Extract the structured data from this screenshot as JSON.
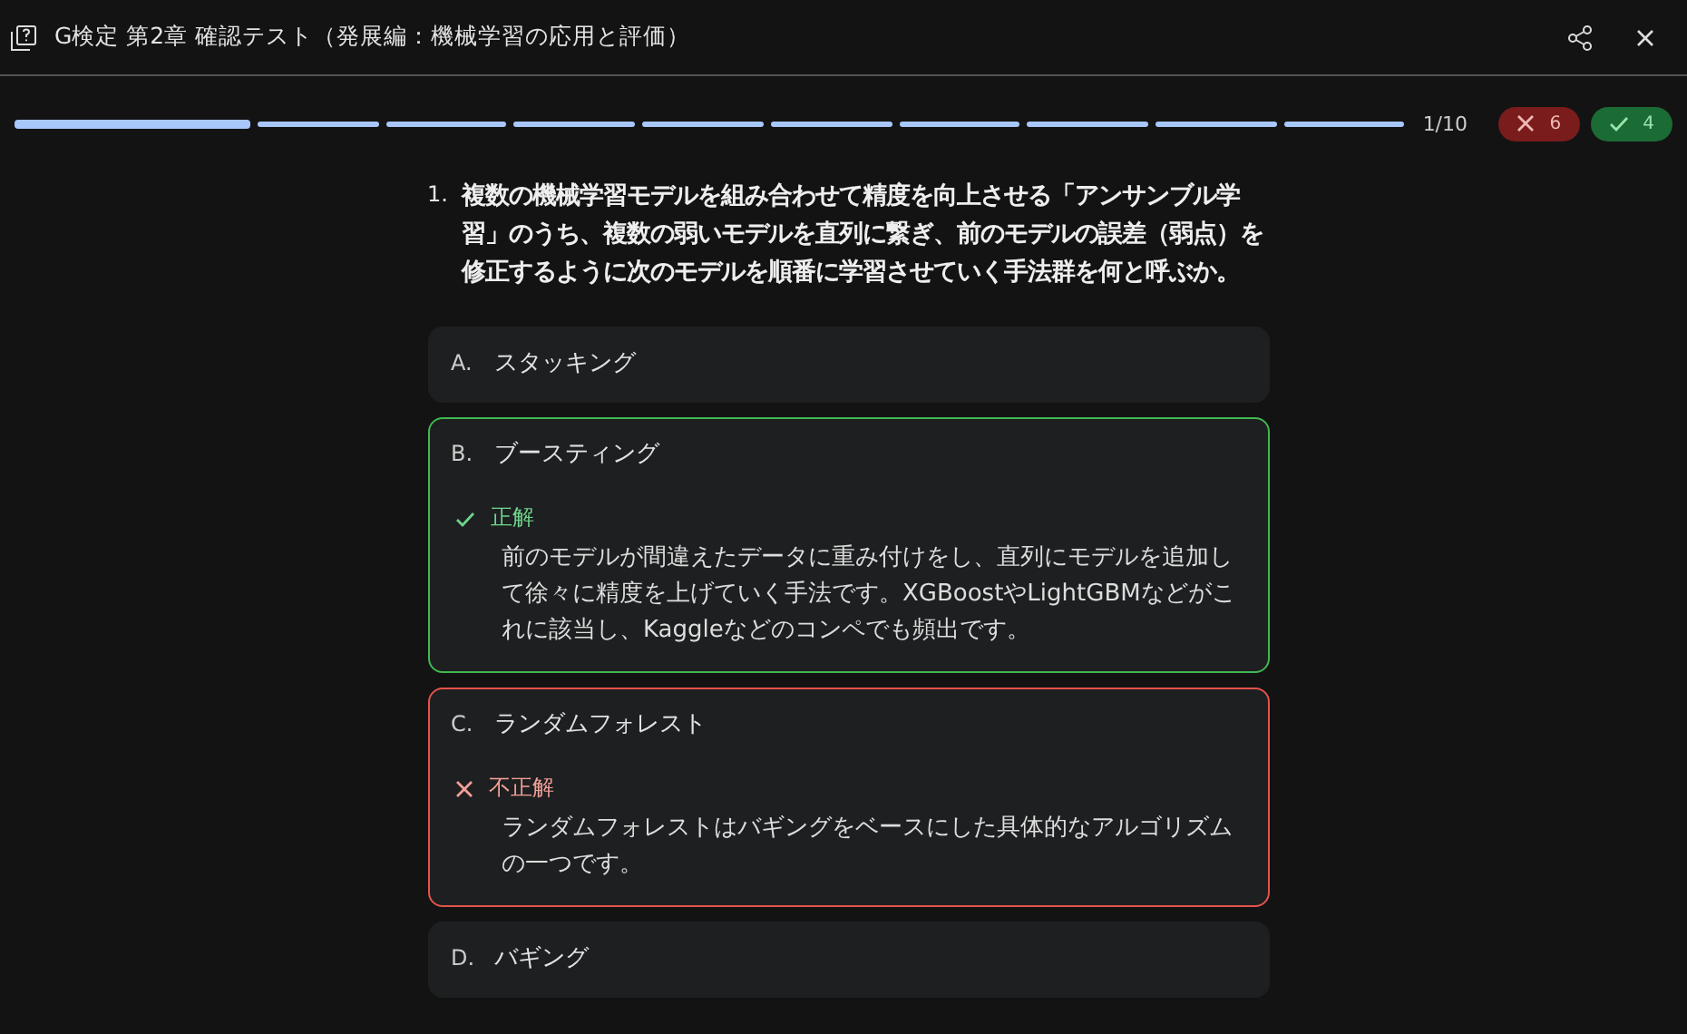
{
  "window": {
    "title": "G検定 第2章 確認テスト（発展編：機械学習の応用と評価）"
  },
  "progress": {
    "segments": [
      {
        "current": true
      },
      {
        "current": false
      },
      {
        "current": false
      },
      {
        "current": false
      },
      {
        "current": false
      },
      {
        "current": false
      },
      {
        "current": false
      },
      {
        "current": false
      },
      {
        "current": false
      },
      {
        "current": false
      }
    ],
    "counter": "1/10",
    "wrong_count": "6",
    "right_count": "4"
  },
  "question": {
    "number": "1.",
    "text": "複数の機械学習モデルを組み合わせて精度を向上させる「アンサンブル学習」のうち、複数の弱いモデルを直列に繋ぎ、前のモデルの誤差（弱点）を修正するように次のモデルを順番に学習させていく手法群を何と呼ぶか。"
  },
  "options": [
    {
      "letter": "A.",
      "text": "スタッキング",
      "kind": "plain"
    },
    {
      "letter": "B.",
      "text": "ブースティング",
      "kind": "correct",
      "verdict": "正解",
      "explanation": "前のモデルが間違えたデータに重み付けをし、直列にモデルを追加して徐々に精度を上げていく手法です。XGBoostやLightGBMなどがこれに該当し、Kaggleなどのコンペでも頻出です。"
    },
    {
      "letter": "C.",
      "text": "ランダムフォレスト",
      "kind": "incorrect",
      "verdict": "不正解",
      "explanation": "ランダムフォレストはバギングをベースにした具体的なアルゴリズムの一つです。"
    },
    {
      "letter": "D.",
      "text": "バギング",
      "kind": "plain"
    }
  ]
}
